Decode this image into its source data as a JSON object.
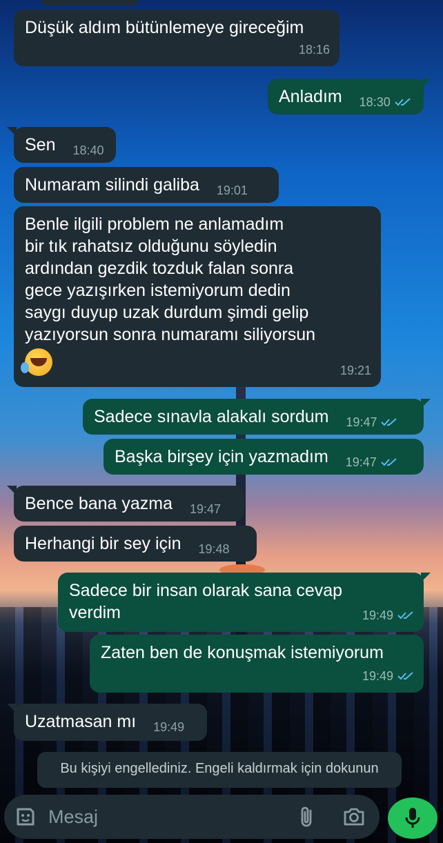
{
  "messages": [
    {
      "text": "Düşük aldım bütünlemeye gireceğim",
      "time": "18:16",
      "dir": "in"
    },
    {
      "text": "Anladım",
      "time": "18:30",
      "dir": "out"
    },
    {
      "text": "Sen",
      "time": "18:40",
      "dir": "in"
    },
    {
      "text": "Numaram silindi galiba",
      "time": "19:01",
      "dir": "in"
    },
    {
      "text": "Benle ilgili problem ne anlamadım\nbir tık rahatsız olduğunu söyledin\nardından gezdik tozduk falan sonra\ngece yazışırken istemiyorum dedin\nsaygı duyup uzak durdum şimdi gelip\nyazıyorsun sonra numaramı siliyorsun",
      "time": "19:21",
      "dir": "in",
      "emoji": "rolling-on-floor-laughing"
    },
    {
      "text": "Sadece sınavla alakalı sordum",
      "time": "19:47",
      "dir": "out"
    },
    {
      "text": "Başka birşey için yazmadım",
      "time": "19:47",
      "dir": "out"
    },
    {
      "text": "Bence bana yazma",
      "time": "19:47",
      "dir": "in"
    },
    {
      "text": "Herhangi bir sey için",
      "time": "19:48",
      "dir": "in"
    },
    {
      "text": "Sadece bir insan olarak sana cevap\nverdim",
      "time": "19:49",
      "dir": "out"
    },
    {
      "text": "Zaten ben de konuşmak istemiyorum",
      "time": "19:49",
      "dir": "out"
    },
    {
      "text": "Uzatmasan mı",
      "time": "19:49",
      "dir": "in"
    }
  ],
  "blocked_notice": "Bu kişiyi engellediniz. Engeli kaldırmak için dokunun",
  "composer": {
    "placeholder": "Mesaj",
    "sticker_icon": "sticker-icon",
    "attach_icon": "paperclip-icon",
    "camera_icon": "camera-icon",
    "mic_icon": "microphone-icon"
  },
  "colors": {
    "incoming_bubble": "#1f2c34",
    "outgoing_bubble": "#0b4f3e",
    "read_ticks": "#53bdeb",
    "mic_button": "#23c15a"
  }
}
